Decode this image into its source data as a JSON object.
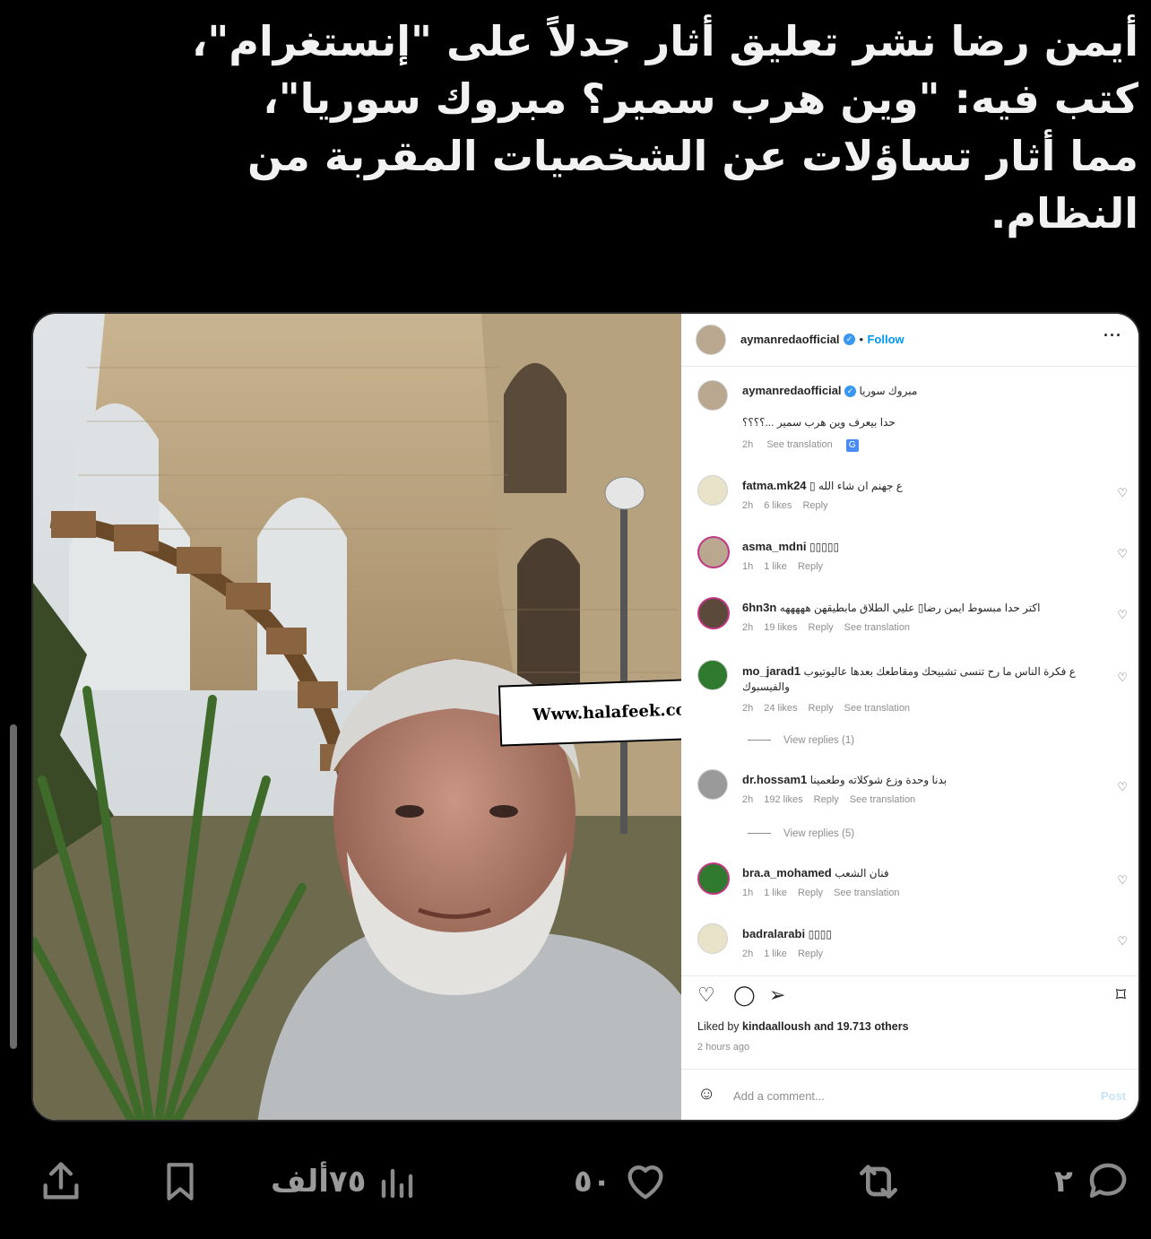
{
  "headline": {
    "lines": [
      "أيمن رضا نشر تعليق أثار جدلاً على \"إنستغرام\"،",
      "كتب فيه: \"وين هرب سمير؟ مبروك سوريا\"،",
      "مما أثار تساؤلات عن الشخصيات المقربة من",
      "النظام."
    ]
  },
  "watermark": "Www.halafeek.com",
  "instagram": {
    "username": "aymanredaofficial",
    "follow_label": "Follow",
    "caption": {
      "username": "aymanredaofficial",
      "text": "مبروك سوريا",
      "text2": "حدا بيعرف وين هرب سمير ...؟؟؟؟",
      "time": "2h",
      "see_translation": "See translation"
    },
    "comments": [
      {
        "user": "fatma.mk24",
        "text": "ع جهنم ان شاء الله ▯",
        "time": "2h",
        "likes": "6 likes",
        "reply": "Reply",
        "translate": ""
      },
      {
        "user": "asma_mdni",
        "text": "▯▯▯▯▯",
        "time": "1h",
        "likes": "1 like",
        "reply": "Reply",
        "translate": ""
      },
      {
        "user": "6hn3n",
        "text": "اكتر حدا مبسوط ايمن رضا▯ عليي الطلاق مابطيقهن هههههه",
        "time": "2h",
        "likes": "19 likes",
        "reply": "Reply",
        "translate": "See translation"
      },
      {
        "user": "mo_jarad1",
        "text": "ع فكرة الناس ما رح تنسى تشبيحك ومقاطعك بعدها عاليوتيوب والفيسبوك",
        "time": "2h",
        "likes": "24 likes",
        "reply": "Reply",
        "translate": "See translation",
        "view_replies": "View replies (1)"
      },
      {
        "user": "dr.hossam1",
        "text": "بدنا وحدة وزع شوكلاته وطعمينا",
        "time": "2h",
        "likes": "192 likes",
        "reply": "Reply",
        "translate": "See translation",
        "view_replies": "View replies (5)"
      },
      {
        "user": "bra.a_mohamed",
        "text": "فنان الشعب",
        "time": "1h",
        "likes": "1 like",
        "reply": "Reply",
        "translate": "See translation"
      },
      {
        "user": "badralarabi",
        "text": "▯▯▯▯",
        "time": "2h",
        "likes": "1 like",
        "reply": "Reply",
        "translate": ""
      }
    ],
    "liked_by_prefix": "Liked by",
    "liked_by_user": "kindaalloush",
    "liked_by_suffix": "and 19.713 others",
    "time_ago": "2 hours ago",
    "add_comment_placeholder": "Add a comment...",
    "post_label": "Post"
  },
  "tweet_actions": {
    "replies": "٢",
    "likes": "٥٠",
    "views": "٧٥ألف"
  }
}
